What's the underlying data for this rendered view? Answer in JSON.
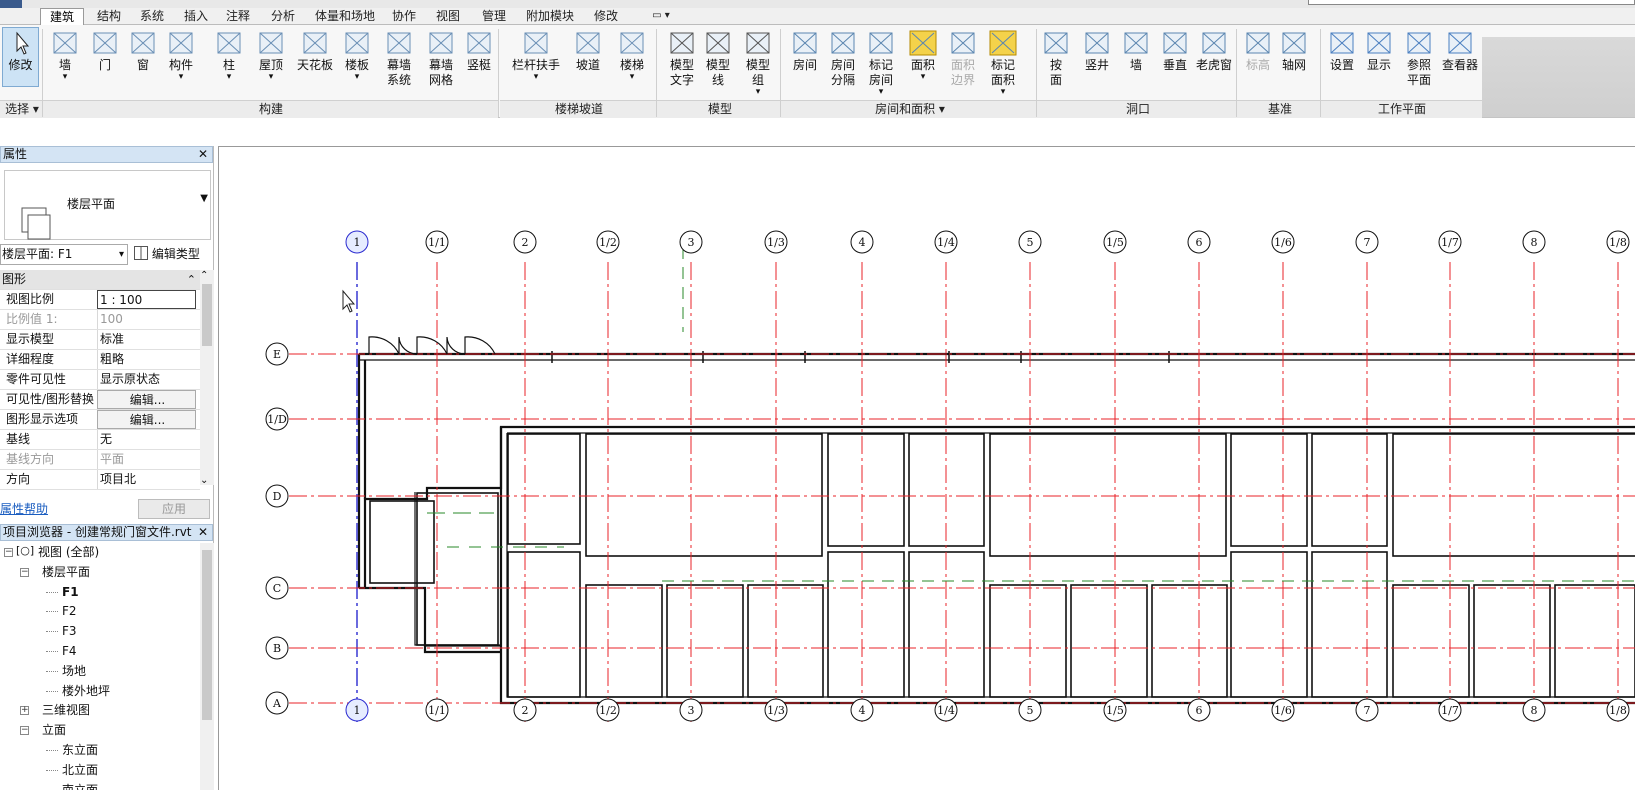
{
  "tabs": [
    "建筑",
    "结构",
    "系统",
    "插入",
    "注释",
    "分析",
    "体量和场地",
    "协作",
    "视图",
    "管理",
    "附加模块",
    "修改"
  ],
  "active_tab": "建筑",
  "ribbon": {
    "modify": {
      "label": "修改"
    },
    "select_label": "选择",
    "build": [
      {
        "label": "墙",
        "dd": true
      },
      {
        "label": "门"
      },
      {
        "label": "窗"
      },
      {
        "label": "构件",
        "dd": true
      },
      {
        "label": "柱",
        "dd": true
      },
      {
        "label": "屋顶",
        "dd": true
      },
      {
        "label": "天花板"
      },
      {
        "label": "楼板",
        "dd": true
      },
      {
        "label": "幕墙\n系统"
      },
      {
        "label": "幕墙\n网格"
      },
      {
        "label": "竖梃"
      }
    ],
    "stairs": [
      {
        "label": "栏杆扶手",
        "dd": true
      },
      {
        "label": "坡道"
      },
      {
        "label": "楼梯",
        "dd": true
      }
    ],
    "model": [
      {
        "label": "模型\n文字"
      },
      {
        "label": "模型\n线"
      },
      {
        "label": "模型\n组",
        "dd": true
      }
    ],
    "room": [
      {
        "label": "房间"
      },
      {
        "label": "房间\n分隔"
      },
      {
        "label": "标记\n房间",
        "dd": true
      },
      {
        "label": "面积",
        "dd": true
      },
      {
        "label": "面积\n边界",
        "disabled": true
      },
      {
        "label": "标记\n面积",
        "dd": true
      }
    ],
    "opening": [
      {
        "label": "按\n面"
      },
      {
        "label": "竖井"
      },
      {
        "label": "墙"
      },
      {
        "label": "垂直"
      },
      {
        "label": "老虎窗"
      }
    ],
    "datum": [
      {
        "label": "标高",
        "disabled": true
      },
      {
        "label": "轴网"
      }
    ],
    "workplane": [
      {
        "label": "设置"
      },
      {
        "label": "显示"
      },
      {
        "label": "参照\n平面"
      },
      {
        "label": "查看器"
      }
    ],
    "groups": {
      "build": "构建",
      "stairs": "楼梯坡道",
      "model": "模型",
      "room": "房间和面积 ▾",
      "opening": "洞口",
      "datum": "基准",
      "workplane": "工作平面"
    }
  },
  "properties": {
    "title": "属性",
    "type_name": "楼层平面",
    "instance_selector": "楼层平面: F1",
    "edit_type": "编辑类型",
    "section": "图形",
    "rows": [
      {
        "k": "视图比例",
        "v": "1 : 100",
        "box": true
      },
      {
        "k": "比例值 1:",
        "v": "100",
        "dim": true
      },
      {
        "k": "显示模型",
        "v": "标准"
      },
      {
        "k": "详细程度",
        "v": "粗略"
      },
      {
        "k": "零件可见性",
        "v": "显示原状态"
      },
      {
        "k": "可见性/图形替换",
        "v": "编辑...",
        "btn": true
      },
      {
        "k": "图形显示选项",
        "v": "编辑...",
        "btn": true
      },
      {
        "k": "基线",
        "v": "无"
      },
      {
        "k": "基线方向",
        "v": "平面",
        "dim": true
      },
      {
        "k": "方向",
        "v": "项目北"
      }
    ],
    "help_link": "属性帮助",
    "apply": "应用"
  },
  "browser": {
    "title": "项目浏览器 - 创建常规门窗文件.rvt",
    "views_all": "视图 (全部)",
    "floor_plans": "楼层平面",
    "floors": [
      "F1",
      "F2",
      "F3",
      "F4",
      "场地",
      "楼外地坪"
    ],
    "three_d": "三维视图",
    "elevations": "立面",
    "elevation_items": [
      "东立面",
      "北立面",
      "南立面"
    ]
  },
  "grids": {
    "vertical": [
      "1",
      "1/1",
      "2",
      "1/2",
      "3",
      "1/3",
      "4",
      "1/4",
      "5",
      "1/5",
      "6",
      "1/6",
      "7",
      "1/7",
      "8",
      "1/8"
    ],
    "horizontal": [
      "E",
      "1/D",
      "D",
      "C",
      "B",
      "A"
    ]
  },
  "colors": {
    "grid_line": "#e8232a",
    "selected_grid": "#2b2bd0",
    "green_dash": "#2a8a2a"
  }
}
